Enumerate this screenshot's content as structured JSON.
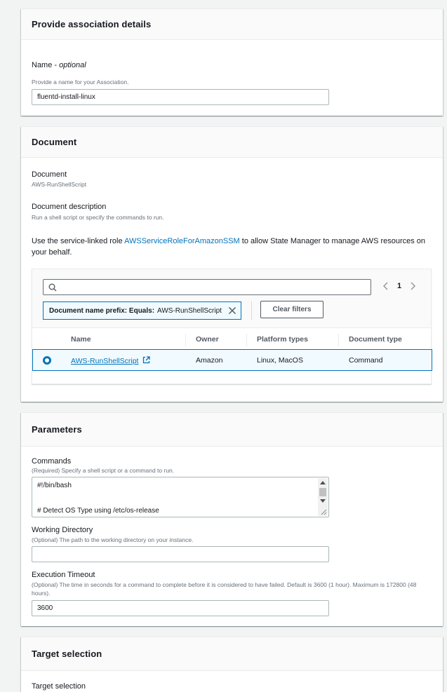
{
  "association": {
    "title": "Provide association details",
    "name_label": "Name - ",
    "name_optional": "optional",
    "name_hint": "Provide a name for your Association.",
    "name_value": "fluentd-install-linux"
  },
  "document": {
    "title": "Document",
    "doc_label": "Document",
    "doc_value": "AWS-RunShellScript",
    "desc_label": "Document description",
    "desc_value": "Run a shell script or specify the commands to run.",
    "role_text_pre": "Use the service-linked role ",
    "role_link": "AWSServiceRoleForAmazonSSM",
    "role_text_post": " to allow State Manager to manage AWS resources on your behalf.",
    "search_value": "",
    "page_number": "1",
    "filter_token_key": "Document name prefix: Equals:",
    "filter_token_value": "AWS-RunShellScript",
    "clear_filters_label": "Clear filters",
    "table": {
      "headers": [
        "Name",
        "Owner",
        "Platform types",
        "Document type"
      ],
      "row": {
        "name": "AWS-RunShellScript",
        "owner": "Amazon",
        "platform": "Linux, MacOS",
        "type": "Command"
      }
    }
  },
  "parameters": {
    "title": "Parameters",
    "commands_label": "Commands",
    "commands_hint": "(Required) Specify a shell script or a command to run.",
    "commands_line1": "#!/bin/bash",
    "commands_line2": "",
    "commands_line3": "# Detect OS Type using /etc/os-release",
    "workdir_label": "Working Directory",
    "workdir_hint": "(Optional) The path to the working directory on your instance.",
    "workdir_value": "",
    "timeout_label": "Execution Timeout",
    "timeout_hint": "(Optional) The time in seconds for a command to complete before it is considered to have failed. Default is 3600 (1 hour). Maximum is 172800 (48 hours).",
    "timeout_value": "3600"
  },
  "target": {
    "title": "Target selection",
    "label": "Target selection"
  },
  "colors": {
    "link": "#0073bb",
    "selected_row_bg": "#f1faff"
  }
}
